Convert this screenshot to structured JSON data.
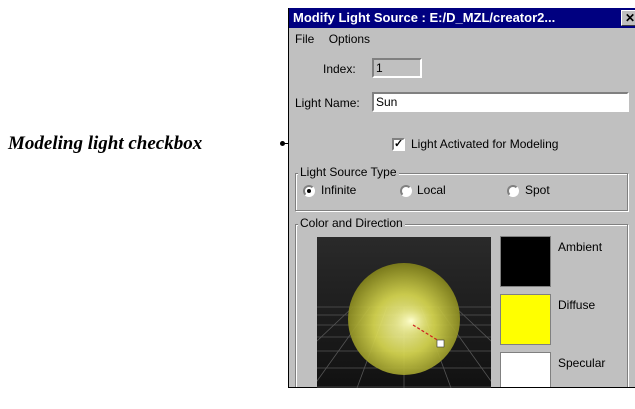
{
  "callout": {
    "text": "Modeling light checkbox"
  },
  "window": {
    "title": "Modify Light Source : E:/D_MZL/creator2...",
    "close_glyph": "✕"
  },
  "menu": {
    "items": [
      "File",
      "Options"
    ]
  },
  "form": {
    "index_label": "Index:",
    "index_value": "1",
    "name_label": "Light Name:",
    "name_value": "Sun",
    "activated_label": "Light Activated for Modeling",
    "activated_checked": true,
    "check_glyph": "✓"
  },
  "light_type": {
    "title": "Light Source Type",
    "options": [
      "Infinite",
      "Local",
      "Spot"
    ],
    "selected": "Infinite"
  },
  "color_dir": {
    "title": "Color and Direction",
    "swatches": [
      {
        "label": "Ambient",
        "color": "#000000"
      },
      {
        "label": "Diffuse",
        "color": "#ffff00"
      },
      {
        "label": "Specular",
        "color": "#ffffff"
      }
    ]
  },
  "colors": {
    "title_bg": "#000080",
    "window_bg": "#c0c0c0"
  }
}
